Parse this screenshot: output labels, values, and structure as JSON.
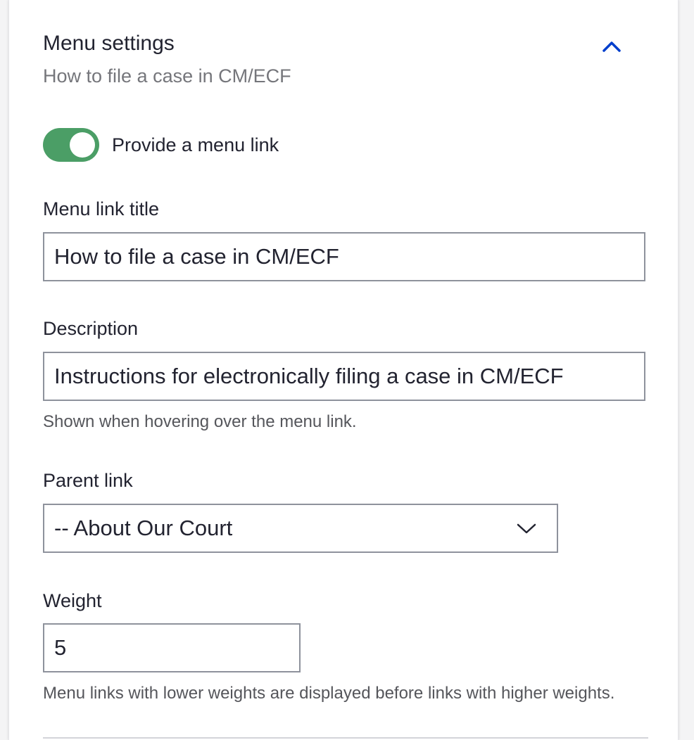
{
  "header": {
    "title": "Menu settings",
    "subtitle": "How to file a case in CM/ECF",
    "collapse_icon": "chevron-up-icon"
  },
  "toggle": {
    "label": "Provide a menu link",
    "checked": true,
    "color": "#4b9e66"
  },
  "menu_link_title": {
    "label": "Menu link title",
    "value": "How to file a case in CM/ECF"
  },
  "description": {
    "label": "Description",
    "value": "Instructions for electronically filing a case in CM/ECF",
    "help": "Shown when hovering over the menu link."
  },
  "parent_link": {
    "label": "Parent link",
    "selected": "-- About Our Court",
    "icon": "chevron-down-icon"
  },
  "weight": {
    "label": "Weight",
    "value": "5",
    "help": "Menu links with lower weights are displayed before links with higher weights."
  },
  "colors": {
    "accent": "#003ecc",
    "toggle_on": "#4b9e66"
  }
}
